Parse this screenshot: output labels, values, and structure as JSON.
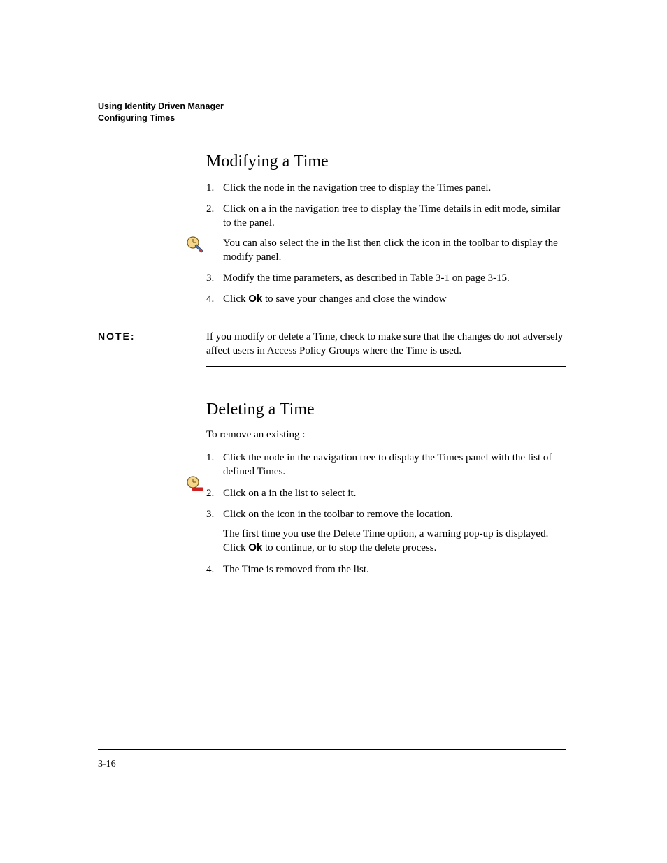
{
  "header": {
    "line1": "Using Identity Driven Manager",
    "line2": "Configuring Times"
  },
  "modifying": {
    "heading": "Modifying a Time",
    "step1_a": "Click the ",
    "step1_b": " node in the ",
    "step1_c": " navigation tree to display the Times panel.",
    "step2_a": "Click on a ",
    "step2_b": " in the navigation tree to display the Time details in edit mode, similar to the ",
    "step2_c": " panel.",
    "step2_sub_a": "You can also select the ",
    "step2_sub_b": " in the list then click the ",
    "step2_sub_c": " icon in the toolbar to display the modify panel.",
    "step3": "Modify the time parameters, as described in Table 3-1 on page 3-15.",
    "step4_a": "Click ",
    "step4_ok": "Ok",
    "step4_b": " to save your changes and close the window"
  },
  "note": {
    "label": "NOTE:",
    "body": "If you modify or delete a Time, check to make sure that the changes do not adversely affect users in Access Policy Groups where the Time is used."
  },
  "deleting": {
    "heading": "Deleting a Time",
    "intro_a": "To remove an existing ",
    "intro_b": ":",
    "step1_a": "Click the ",
    "step1_b": " node in the ",
    "step1_c": " navigation tree to display the Times panel with the list of defined Times.",
    "step2_a": "Click on a ",
    "step2_b": " in the list to select it.",
    "step3_a": "Click on the ",
    "step3_b": " icon in the toolbar to remove the location.",
    "step3_sub_a": "The first time you use the Delete Time option, a warning pop-up is displayed. Click ",
    "step3_sub_ok": "Ok",
    "step3_sub_b": " to continue, or ",
    "step3_sub_c": " to stop the delete process.",
    "step4_a": "The Time is removed from the ",
    "step4_b": " list."
  },
  "footer": {
    "page": "3-16"
  }
}
